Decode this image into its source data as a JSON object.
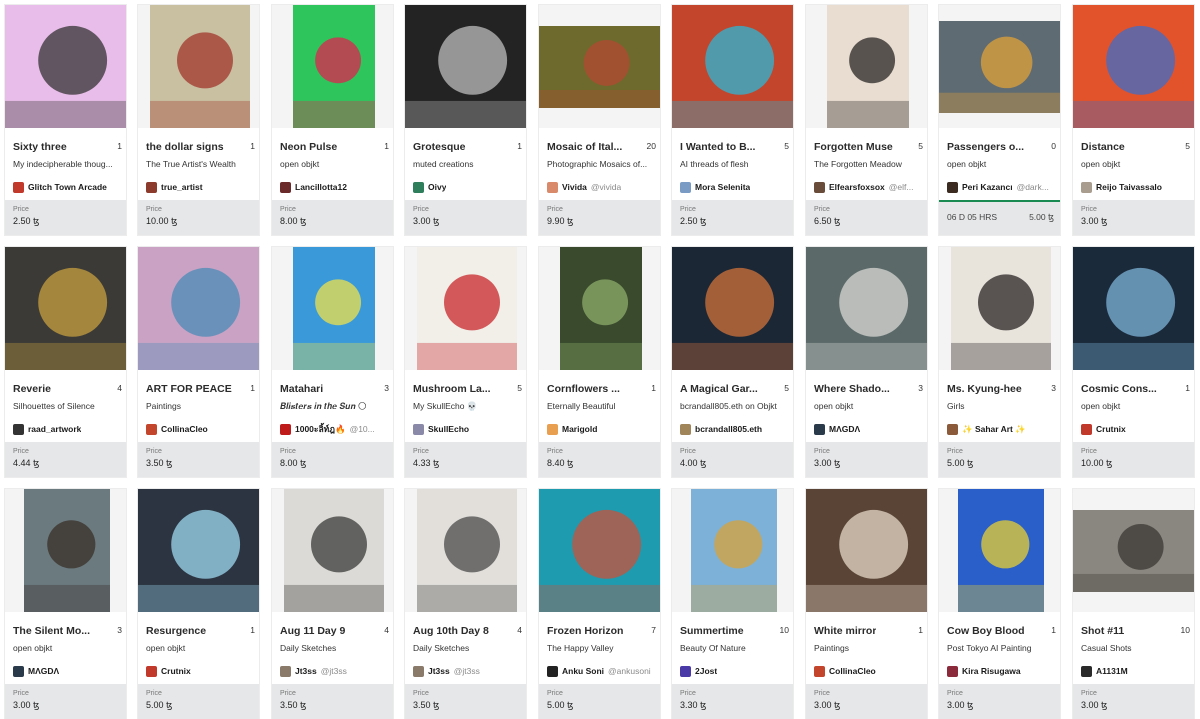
{
  "cards": [
    {
      "title": "Sixty three",
      "count": "1",
      "collection": "My indecipherable thoug...",
      "creator": "Glitch Town Arcade",
      "handle": "",
      "price_label": "Price",
      "price": "2.50 ꜩ",
      "art_bg": "#e9bde9",
      "art_accent": "#333333",
      "avatar_color": "#c0392b",
      "art_w": 123,
      "art_h": 123,
      "frame_bg": "#0f2d23"
    },
    {
      "title": "the dollar signs",
      "count": "1",
      "collection": "The True Artist's Wealth",
      "creator": "true_artist",
      "handle": "",
      "price_label": "Price",
      "price": "10.00 ꜩ",
      "art_bg": "#c9c0a2",
      "art_accent": "#a0362b",
      "avatar_color": "#8b3a2b",
      "art_w": 100,
      "art_h": 123
    },
    {
      "title": "Neon Pulse",
      "count": "1",
      "collection": "open objkt",
      "creator": "Lancillotta12",
      "handle": "",
      "price_label": "Price",
      "price": "8.00 ꜩ",
      "art_bg": "#2ec55d",
      "art_accent": "#e0234f",
      "avatar_color": "#6b2a2a",
      "art_w": 82,
      "art_h": 123
    },
    {
      "title": "Grotesque",
      "count": "1",
      "collection": "muted creations",
      "creator": "Oivy",
      "handle": "",
      "price_label": "Price",
      "price": "3.00 ꜩ",
      "art_bg": "#232323",
      "art_accent": "#bdbdbd",
      "avatar_color": "#2e7d5b",
      "art_w": 123,
      "art_h": 123
    },
    {
      "title": "Mosaic of Ital...",
      "count": "20",
      "collection": "Photographic Mosaics of...",
      "creator": "Vivida",
      "handle": "@vivida",
      "price_label": "Price",
      "price": "9.90 ꜩ",
      "art_bg": "#6e6a2d",
      "art_accent": "#b34a32",
      "avatar_color": "#d98a6a",
      "art_w": 123,
      "art_h": 82
    },
    {
      "title": "I Wanted to B...",
      "count": "5",
      "collection": "AI threads of flesh",
      "creator": "Mora Selenita",
      "handle": "",
      "price_label": "Price",
      "price": "2.50 ꜩ",
      "art_bg": "#c2452c",
      "art_accent": "#2bb7d6",
      "avatar_color": "#7a9cc4",
      "art_w": 123,
      "art_h": 123
    },
    {
      "title": "Forgotten Muse",
      "count": "5",
      "collection": "The Forgotten Meadow",
      "creator": "Elfearsfoxsox",
      "handle": "@elf...",
      "price_label": "Price",
      "price": "6.50 ꜩ",
      "art_bg": "#e8ddd0",
      "art_accent": "#2a2424",
      "avatar_color": "#6a4c3a",
      "art_w": 82,
      "art_h": 123
    },
    {
      "title": "Passengers o...",
      "count": "0",
      "collection": "open objkt",
      "creator": "Peri Kazancı",
      "handle": "@dark...",
      "auction_time": "06 D  05 HRS",
      "auction_price": "5.00 ꜩ",
      "art_bg": "#5f6b72",
      "art_accent": "#e0a13a",
      "avatar_color": "#3a2a20",
      "art_w": 123,
      "art_h": 92
    },
    {
      "title": "Distance",
      "count": "5",
      "collection": "open objkt",
      "creator": "Reijo Taivassalo",
      "handle": "",
      "price_label": "Price",
      "price": "3.00 ꜩ",
      "art_bg": "#e2532b",
      "art_accent": "#3d6cc9",
      "avatar_color": "#a89d8e",
      "art_w": 123,
      "art_h": 123
    },
    {
      "title": "Reverie",
      "count": "4",
      "collection": "Silhouettes of Silence",
      "creator": "raad_artwork",
      "handle": "",
      "price_label": "Price",
      "price": "4.44 ꜩ",
      "art_bg": "#3c3a37",
      "art_accent": "#c7a23f",
      "avatar_color": "#333333",
      "art_w": 123,
      "art_h": 123
    },
    {
      "title": "ART FOR PEACE",
      "count": "1",
      "collection": "Paintings",
      "creator": "CollinaCleo",
      "handle": "",
      "price_label": "Price",
      "price": "3.50 ꜩ",
      "art_bg": "#c9a2c4",
      "art_accent": "#4a8bb7",
      "avatar_color": "#c2452c",
      "art_w": 123,
      "art_h": 123
    },
    {
      "title": "Matahari",
      "count": "3",
      "collection": "𝑩𝒍𝒊𝒔𝒕𝒆𝒓𝒔 𝒊𝒏 𝒕𝒉𝒆 𝑺𝒖𝒏 🌕",
      "creator": "1000ะลิ้ท์ฎ🔥",
      "handle": "@10...",
      "price_label": "Price",
      "price": "8.00 ꜩ",
      "art_bg": "#3a9ad9",
      "art_accent": "#f0e04a",
      "avatar_color": "#c01b1b",
      "art_w": 82,
      "art_h": 123
    },
    {
      "title": "Mushroom La...",
      "count": "5",
      "collection": "My SkullEcho 💀",
      "creator": "SkullEcho",
      "handle": "",
      "price_label": "Price",
      "price": "4.33 ꜩ",
      "art_bg": "#f2efe8",
      "art_accent": "#c8262b",
      "avatar_color": "#8a8aa8",
      "art_w": 100,
      "art_h": 123
    },
    {
      "title": "Cornflowers ...",
      "count": "1",
      "collection": "Eternally Beautiful",
      "creator": "Marigold",
      "handle": "",
      "price_label": "Price",
      "price": "8.40 ꜩ",
      "art_bg": "#394a2d",
      "art_accent": "#8fae6b",
      "avatar_color": "#e8a050",
      "art_w": 82,
      "art_h": 123
    },
    {
      "title": "A Magical Gar...",
      "count": "5",
      "collection": "bcrandall805.eth on Objkt",
      "creator": "bcrandall805.eth",
      "handle": "",
      "price_label": "Price",
      "price": "4.00 ꜩ",
      "art_bg": "#1c2736",
      "art_accent": "#d0743a",
      "avatar_color": "#a0855b",
      "art_w": 123,
      "art_h": 123
    },
    {
      "title": "Where Shado...",
      "count": "3",
      "collection": "open objkt",
      "creator": "MΛGDΛ",
      "handle": "",
      "price_label": "Price",
      "price": "3.00 ꜩ",
      "art_bg": "#5b6a69",
      "art_accent": "#d8d8d4",
      "avatar_color": "#2a3a4a",
      "art_w": 123,
      "art_h": 123
    },
    {
      "title": "Ms. Kyung-hee",
      "count": "3",
      "collection": "Girls",
      "creator": "✨ Sahar Art ✨",
      "handle": "",
      "price_label": "Price",
      "price": "5.00 ꜩ",
      "art_bg": "#e8e4dc",
      "art_accent": "#2a2424",
      "avatar_color": "#8a5a3a",
      "art_w": 100,
      "art_h": 123
    },
    {
      "title": "Cosmic Cons...",
      "count": "1",
      "collection": "open objkt",
      "creator": "Crutnix",
      "handle": "",
      "price_label": "Price",
      "price": "10.00 ꜩ",
      "art_bg": "#1a2a3a",
      "art_accent": "#7fb4d9",
      "avatar_color": "#c0392b",
      "art_w": 123,
      "art_h": 123
    },
    {
      "title": "The Silent Mo...",
      "count": "3",
      "collection": "open objkt",
      "creator": "MΛGDΛ",
      "handle": "",
      "price_label": "Price",
      "price": "3.00 ꜩ",
      "art_bg": "#6a7a7e",
      "art_accent": "#3a2f28",
      "avatar_color": "#2a3a4a",
      "art_w": 86,
      "art_h": 123
    },
    {
      "title": "Resurgence",
      "count": "1",
      "collection": "open objkt",
      "creator": "Crutnix",
      "handle": "",
      "price_label": "Price",
      "price": "5.00 ꜩ",
      "art_bg": "#2b3440",
      "art_accent": "#9fd8f0",
      "avatar_color": "#c0392b",
      "art_w": 123,
      "art_h": 123
    },
    {
      "title": "Aug 11 Day 9",
      "count": "4",
      "collection": "Daily Sketches",
      "creator": "Jt3ss",
      "handle": "@jt3ss",
      "price_label": "Price",
      "price": "3.50 ꜩ",
      "art_bg": "#dcdad6",
      "art_accent": "#3a3a3a",
      "avatar_color": "#8a7a6a",
      "art_w": 100,
      "art_h": 123
    },
    {
      "title": "Aug 10th Day 8",
      "count": "4",
      "collection": "Daily Sketches",
      "creator": "Jt3ss",
      "handle": "@jt3ss",
      "price_label": "Price",
      "price": "3.50 ꜩ",
      "art_bg": "#e2dfdb",
      "art_accent": "#4a4a4a",
      "avatar_color": "#8a7a6a",
      "art_w": 100,
      "art_h": 123
    },
    {
      "title": "Frozen Horizon",
      "count": "7",
      "collection": "The Happy Valley",
      "creator": "Anku Soni",
      "handle": "@ankusoni",
      "price_label": "Price",
      "price": "5.00 ꜩ",
      "art_bg": "#1f9bb0",
      "art_accent": "#c8513a",
      "avatar_color": "#222222",
      "art_w": 123,
      "art_h": 123
    },
    {
      "title": "Summertime",
      "count": "10",
      "collection": "Beauty Of Nature",
      "creator": "2Jost",
      "handle": "",
      "price_label": "Price",
      "price": "3.30 ꜩ",
      "art_bg": "#7db1d8",
      "art_accent": "#d8a33a",
      "avatar_color": "#4a3aa8",
      "art_w": 86,
      "art_h": 123
    },
    {
      "title": "White mirror",
      "count": "1",
      "collection": "Paintings",
      "creator": "CollinaCleo",
      "handle": "",
      "price_label": "Price",
      "price": "3.00 ꜩ",
      "art_bg": "#5a4436",
      "art_accent": "#e6d8c8",
      "avatar_color": "#c2452c",
      "art_w": 123,
      "art_h": 123
    },
    {
      "title": "Cow Boy Blood",
      "count": "1",
      "collection": "Post Tokyo AI Painting",
      "creator": "Kira Risugawa",
      "handle": "",
      "price_label": "Price",
      "price": "3.00 ꜩ",
      "art_bg": "#2a5ec8",
      "art_accent": "#e8d030",
      "avatar_color": "#8a2a3a",
      "art_w": 86,
      "art_h": 123
    },
    {
      "title": "Shot #11",
      "count": "10",
      "collection": "Casual Shots",
      "creator": "A1131M",
      "handle": "",
      "price_label": "Price",
      "price": "3.00 ꜩ",
      "art_bg": "#8a8680",
      "art_accent": "#3a3632",
      "avatar_color": "#2a2a2a",
      "art_w": 123,
      "art_h": 82
    }
  ]
}
